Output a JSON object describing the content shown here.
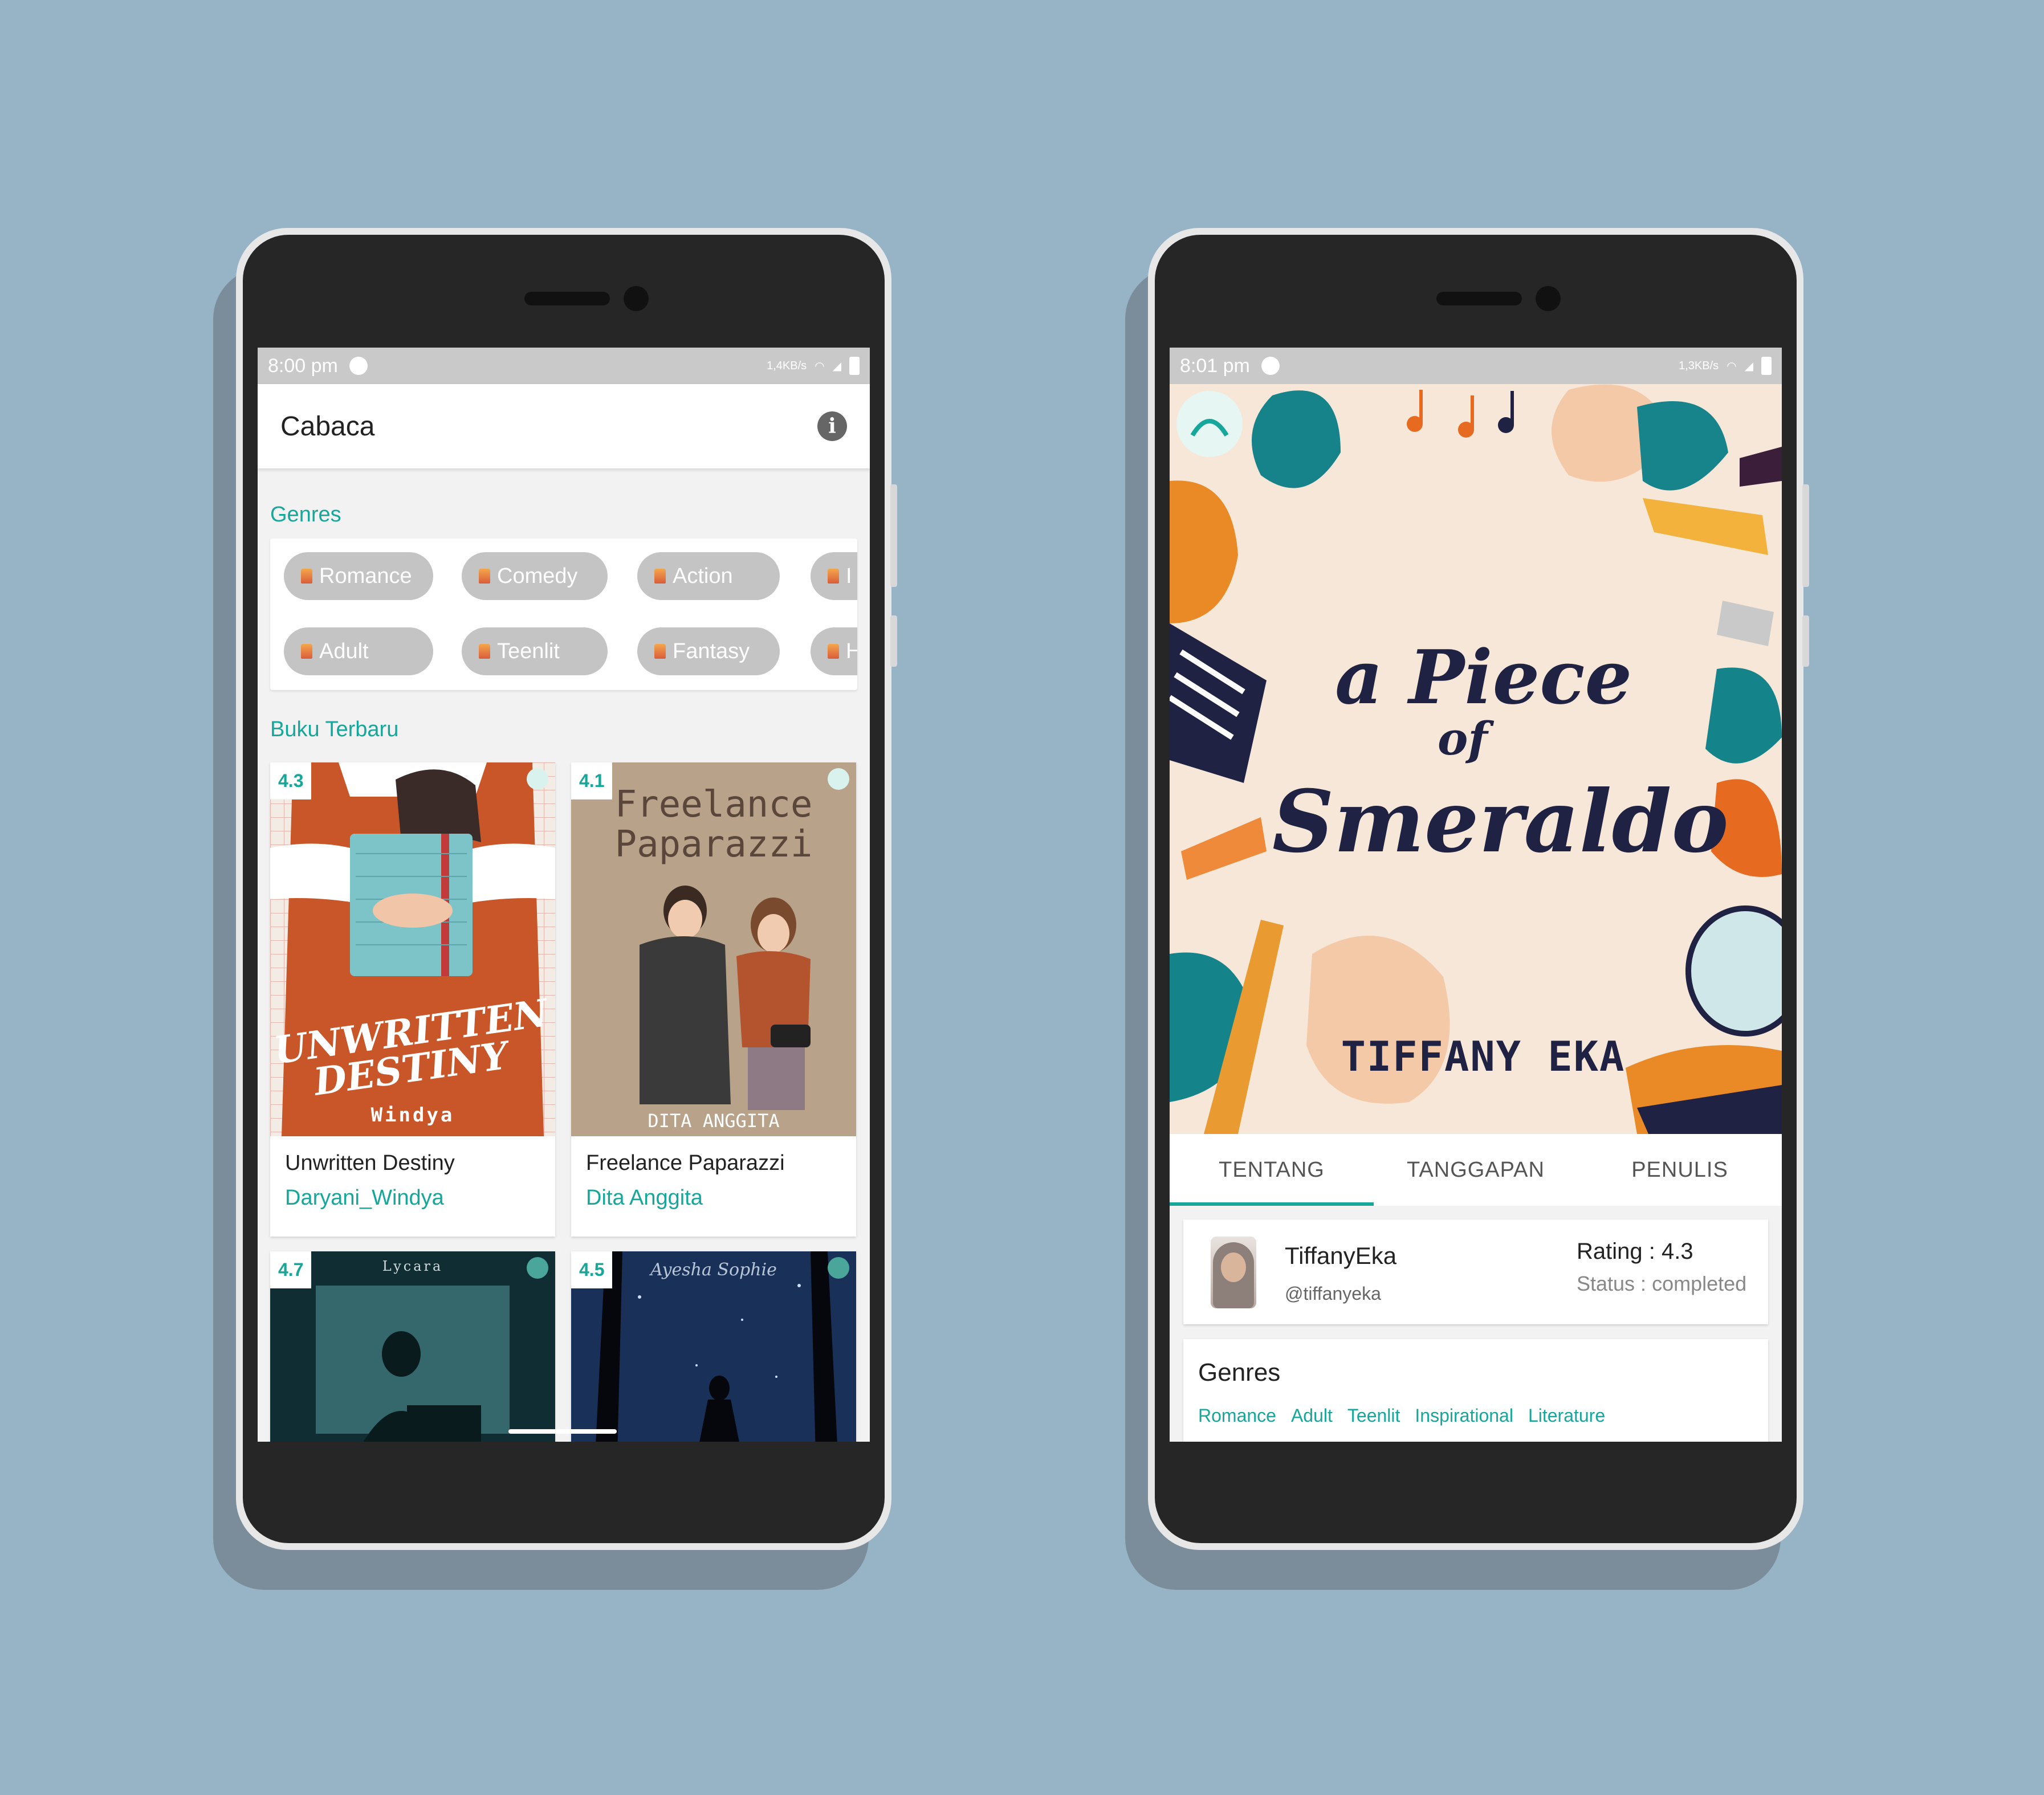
{
  "left_phone": {
    "status": {
      "time": "8:00 pm",
      "net_speed": "1,4KB/s"
    },
    "appbar": {
      "title": "Cabaca"
    },
    "genres_label": "Genres",
    "genre_row1": [
      "Romance",
      "Comedy",
      "Action",
      "I"
    ],
    "genre_row2": [
      "Adult",
      "Teenlit",
      "Fantasy",
      "H"
    ],
    "latest_label": "Buku Terbaru",
    "books": [
      {
        "rating": "4.3",
        "title": "Unwritten Destiny",
        "author": "Daryani_Windya",
        "cover_title1": "UNWRITTEN",
        "cover_title2": "DESTINY",
        "cover_author": "Windya"
      },
      {
        "rating": "4.1",
        "title": "Freelance Paparazzi",
        "author": "Dita Anggita",
        "cover_title1": "Freelance",
        "cover_title2": "Paparazzi",
        "cover_author": "DITA ANGGITA"
      },
      {
        "rating": "4.7",
        "cover_author": "Lycara"
      },
      {
        "rating": "4.5",
        "cover_author": "Ayesha Sophie"
      }
    ]
  },
  "right_phone": {
    "status": {
      "time": "8:01 pm",
      "net_speed": "1,3KB/s"
    },
    "cover": {
      "line1": "a Piece",
      "line2": "of",
      "line3": "Smeraldo",
      "author": "TIFFANY EKA"
    },
    "tabs": [
      "TENTANG",
      "TANGGAPAN",
      "PENULIS"
    ],
    "author": {
      "name": "TiffanyEka",
      "handle": "@tiffanyeka",
      "rating": "Rating : 4.3",
      "status": "Status : completed"
    },
    "genres_title": "Genres",
    "genres": [
      "Romance",
      "Adult",
      "Teenlit",
      "Inspirational",
      "Literature"
    ]
  },
  "colors": {
    "accent": "#16a79a",
    "background": "#97b4c7",
    "chip": "#c4c4c4"
  }
}
